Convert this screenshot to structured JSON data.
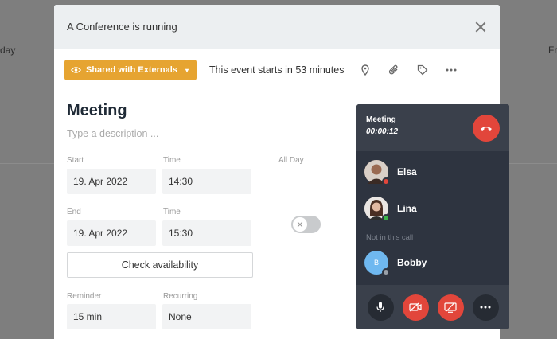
{
  "background": {
    "day_left": "day",
    "day_right": "Fr"
  },
  "banner": {
    "text": "A Conference is running"
  },
  "toolbar": {
    "share_label": "Shared with Externals",
    "starts_text": "This event starts in 53 minutes",
    "icons": [
      "location-pin-icon",
      "paperclip-icon",
      "tag-icon",
      "more-horizontal-icon"
    ]
  },
  "form": {
    "title": "Meeting",
    "description_placeholder": "Type a description ...",
    "start_label": "Start",
    "start_date": "19. Apr 2022",
    "start_time_label": "Time",
    "start_time": "14:30",
    "allday_label": "All Day",
    "end_label": "End",
    "end_date": "19. Apr 2022",
    "end_time_label": "Time",
    "end_time": "15:30",
    "check_label": "Check availability",
    "reminder_label": "Reminder",
    "reminder_value": "15 min",
    "recurring_label": "Recurring",
    "recurring_value": "None"
  },
  "call": {
    "title": "Meeting",
    "duration": "00:00:12",
    "participants": [
      {
        "name": "Elsa",
        "status_color": "#e2463b"
      },
      {
        "name": "Lina",
        "status_color": "#3cb44a"
      }
    ],
    "not_in_call_label": "Not in this call",
    "absent": [
      {
        "name": "Bobby",
        "initial": "B",
        "status_color": "#9aa0a8"
      }
    ]
  },
  "colors": {
    "accent": "#e6a431",
    "danger": "#e2463b",
    "widget_bg": "#2e3440"
  }
}
